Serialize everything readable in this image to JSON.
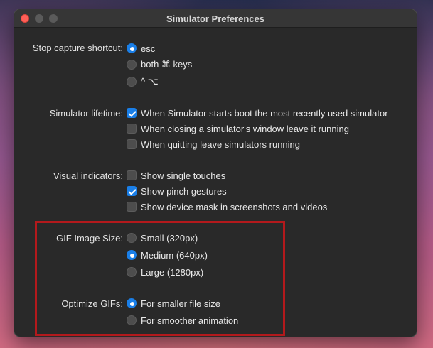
{
  "window": {
    "title": "Simulator Preferences"
  },
  "sections": {
    "capture": {
      "label": "Stop capture shortcut:",
      "options": [
        {
          "text": "esc",
          "selected": true
        },
        {
          "text": "both ⌘ keys",
          "selected": false
        },
        {
          "text": "^ ⌥",
          "selected": false
        }
      ]
    },
    "lifetime": {
      "label": "Simulator lifetime:",
      "options": [
        {
          "text": "When Simulator starts boot the most recently used simulator",
          "checked": true
        },
        {
          "text": "When closing a simulator's window leave it running",
          "checked": false
        },
        {
          "text": "When quitting leave simulators running",
          "checked": false
        }
      ]
    },
    "indicators": {
      "label": "Visual indicators:",
      "options": [
        {
          "text": "Show single touches",
          "checked": false
        },
        {
          "text": "Show pinch gestures",
          "checked": true
        },
        {
          "text": "Show device mask in screenshots and videos",
          "checked": false
        }
      ]
    },
    "gif_size": {
      "label": "GIF Image Size:",
      "options": [
        {
          "text": "Small (320px)",
          "selected": false
        },
        {
          "text": "Medium (640px)",
          "selected": true
        },
        {
          "text": "Large (1280px)",
          "selected": false
        }
      ]
    },
    "optimize": {
      "label": "Optimize GIFs:",
      "options": [
        {
          "text": "For smaller file size",
          "selected": true
        },
        {
          "text": "For smoother animation",
          "selected": false
        }
      ]
    }
  },
  "colors": {
    "accent": "#1a7fe8",
    "highlight_box": "#b3191c",
    "window_bg": "#292929"
  }
}
